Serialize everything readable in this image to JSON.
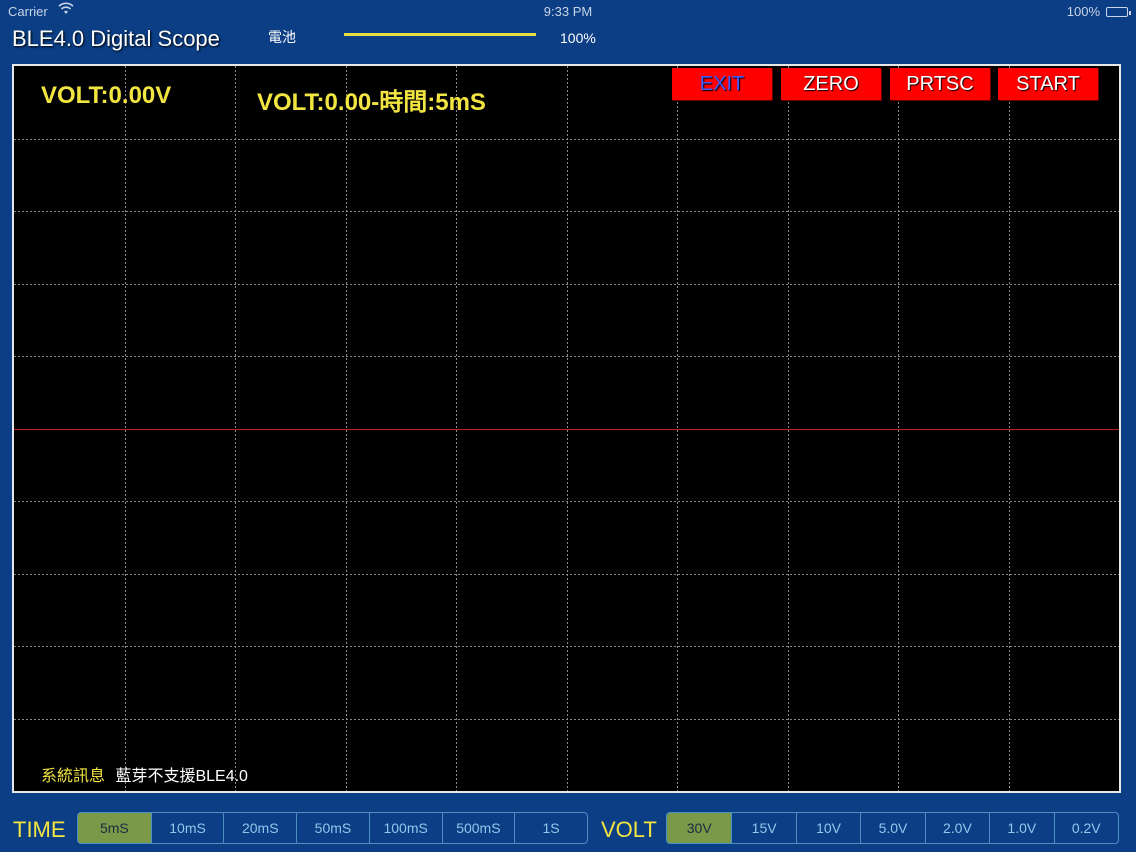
{
  "status_bar": {
    "carrier": "Carrier",
    "time": "9:33 PM",
    "battery": "100%"
  },
  "header": {
    "title": "BLE4.0 Digital Scope",
    "battery_label": "電池",
    "battery_percent": "100%",
    "battery_level": 1.0,
    "battery_bar_color": "#e6e046"
  },
  "scope": {
    "volt_readout": "VOLT:0.00V",
    "volt_time_readout": "VOLT:0.00-時間:5mS",
    "buttons": {
      "exit": "EXIT",
      "zero": "ZERO",
      "prtsc": "PRTSC",
      "start": "START"
    },
    "system_label": "系統訊息",
    "system_message": "藍芽不支援BLE4.0",
    "colors": {
      "grid": "#8a8a8a",
      "center_line": "#c0201a",
      "readout": "#f2e441",
      "button": "#ff0000"
    }
  },
  "time_control": {
    "label": "TIME",
    "options": [
      "5mS",
      "10mS",
      "20mS",
      "50mS",
      "100mS",
      "500mS",
      "1S"
    ],
    "selected": "5mS"
  },
  "volt_control": {
    "label": "VOLT",
    "options": [
      "30V",
      "15V",
      "10V",
      "5.0V",
      "2.0V",
      "1.0V",
      "0.2V"
    ],
    "selected": "30V"
  }
}
